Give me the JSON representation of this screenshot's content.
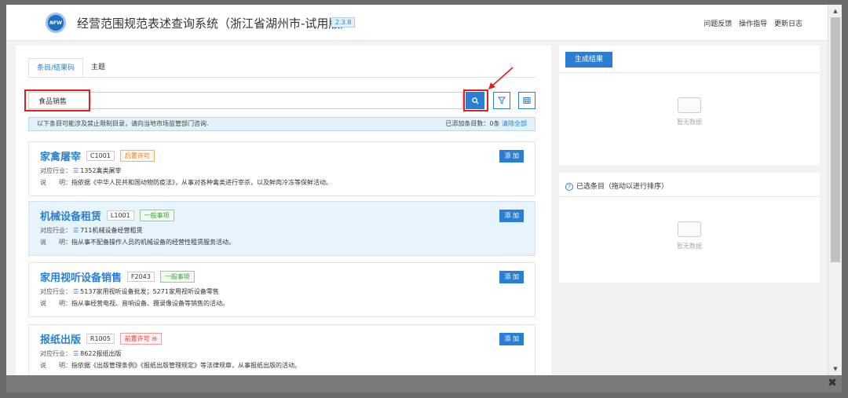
{
  "header": {
    "logo_text": "NFW",
    "title": "经营范围规范表述查询系统（浙江省湖州市-试用版）",
    "version": "2.3.8",
    "links": [
      "问题反馈",
      "操作指导",
      "更新日志"
    ]
  },
  "tabs": [
    {
      "label": "条目/结果码",
      "active": true
    },
    {
      "label": "主题",
      "active": false
    }
  ],
  "search": {
    "value": "食品销售",
    "placeholder": ""
  },
  "notice": {
    "text": "以下条目可能涉及禁止限制目录，请向当地市场监管部门咨询.",
    "added_prefix": "已添加条目数：",
    "added_count": "0条",
    "clear_label": "清除全部"
  },
  "items": [
    {
      "name": "家禽屠宰",
      "code": "C1001",
      "tag": "后置许可",
      "tag_color": "orange",
      "industry_label": "对应行业：",
      "industry": "1352禽类屠宰",
      "desc_label": "说　　明：",
      "desc": "指依据《中华人民共和国动物防疫法》，从事对各种禽类进行宰杀，以及鲜肉冷冻等保鲜活动。",
      "add_label": "添 加",
      "selected": false
    },
    {
      "name": "机械设备租赁",
      "code": "L1001",
      "tag": "一般事项",
      "tag_color": "green",
      "industry_label": "对应行业：",
      "industry": "711机械设备经营租赁",
      "desc_label": "说　　明：",
      "desc": "指从事不配备操作人员的机械设备的经营性租赁服务活动。",
      "add_label": "添 加",
      "selected": true
    },
    {
      "name": "家用视听设备销售",
      "code": "F2043",
      "tag": "一般事项",
      "tag_color": "green",
      "industry_label": "对应行业：",
      "industry": "5137家用视听设备批发；5271家用视听设备零售",
      "desc_label": "说　　明：",
      "desc": "指从事经营电视、音响设备、摄录像设备等销售的活动。",
      "add_label": "添 加",
      "selected": false
    },
    {
      "name": "报纸出版",
      "code": "R1005",
      "tag": "前置许可 ⊖",
      "tag_color": "red",
      "industry_label": "对应行业：",
      "industry": "8622报纸出版",
      "desc_label": "说　　明：",
      "desc": "指依据《出版管理条例》《报纸出版管理规定》等法律规章，从事报纸出版的活动。",
      "add_label": "添 加",
      "selected": false
    }
  ],
  "right": {
    "generate_label": "生成结果",
    "empty_text": "暂无数据",
    "selected_title": "已选条目（拖动以进行排序）",
    "empty_text2": "暂无数据"
  },
  "colors": {
    "accent": "#2a7fd4",
    "highlight_red": "#e02020"
  }
}
